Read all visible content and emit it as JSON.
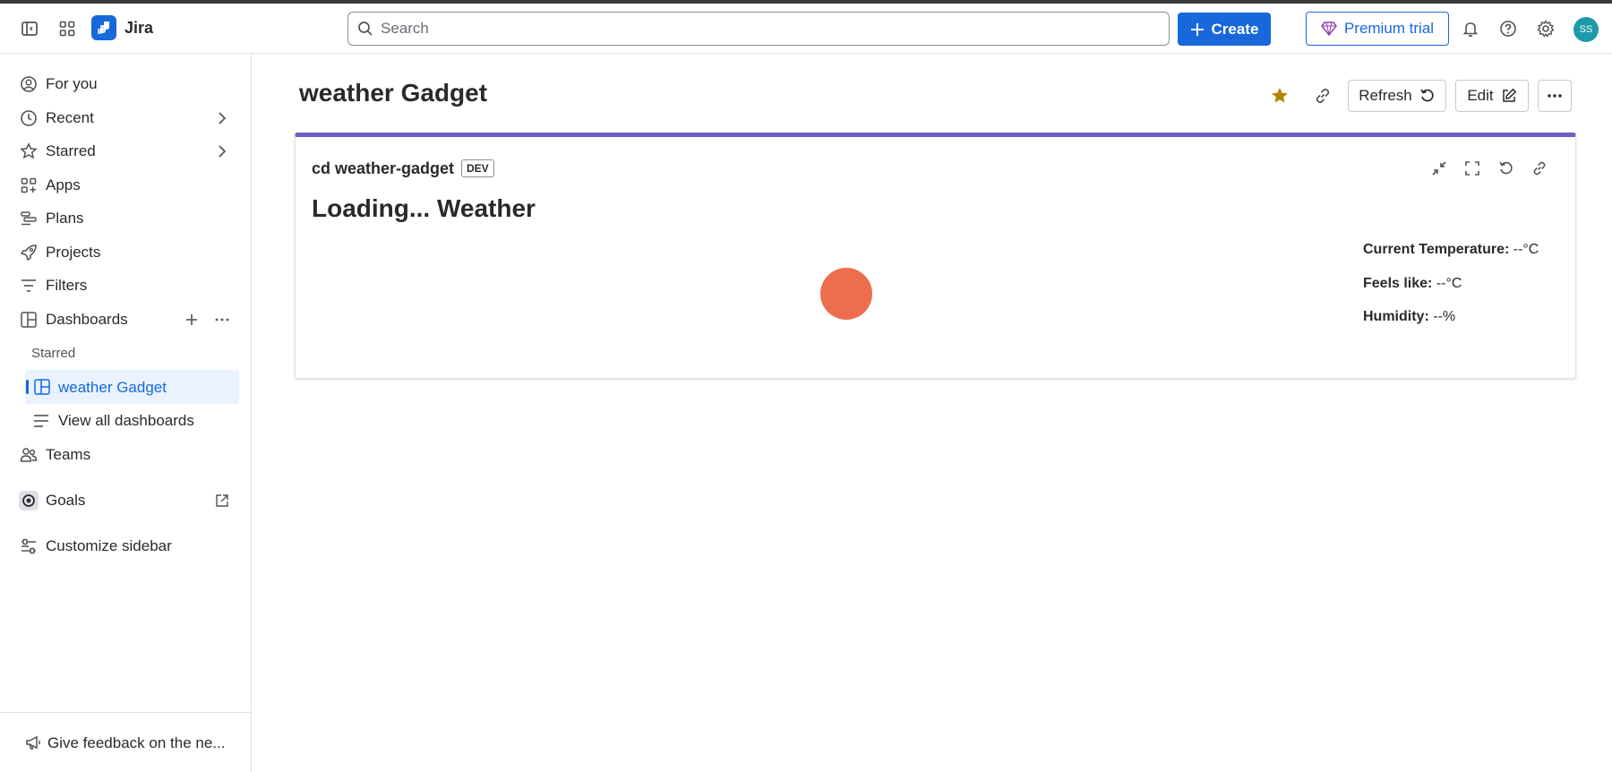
{
  "app": {
    "name": "Jira"
  },
  "topbar": {
    "search_placeholder": "Search",
    "create_label": "Create",
    "premium_label": "Premium trial",
    "avatar_initials": "SS"
  },
  "sidebar": {
    "items": [
      {
        "label": "For you"
      },
      {
        "label": "Recent"
      },
      {
        "label": "Starred"
      },
      {
        "label": "Apps"
      },
      {
        "label": "Plans"
      },
      {
        "label": "Projects"
      },
      {
        "label": "Filters"
      },
      {
        "label": "Dashboards"
      }
    ],
    "starred_section": "Starred",
    "active_dashboard": "weather Gadget",
    "view_all": "View all dashboards",
    "teams": "Teams",
    "goals": "Goals",
    "customize": "Customize sidebar",
    "feedback": "Give feedback on the ne..."
  },
  "page": {
    "title": "weather Gadget",
    "refresh_label": "Refresh",
    "edit_label": "Edit"
  },
  "gadget": {
    "title": "cd weather-gadget",
    "badge": "DEV",
    "heading": "Loading... Weather",
    "stats": [
      {
        "label": "Current Temperature:",
        "value": "--°C"
      },
      {
        "label": "Feels like:",
        "value": "--°C"
      },
      {
        "label": "Humidity:",
        "value": "--%"
      }
    ],
    "loader_color": "#ec6e4e",
    "accent_color": "#6e5dc6"
  },
  "colors": {
    "brand": "#1868db",
    "star": "#b38600"
  }
}
